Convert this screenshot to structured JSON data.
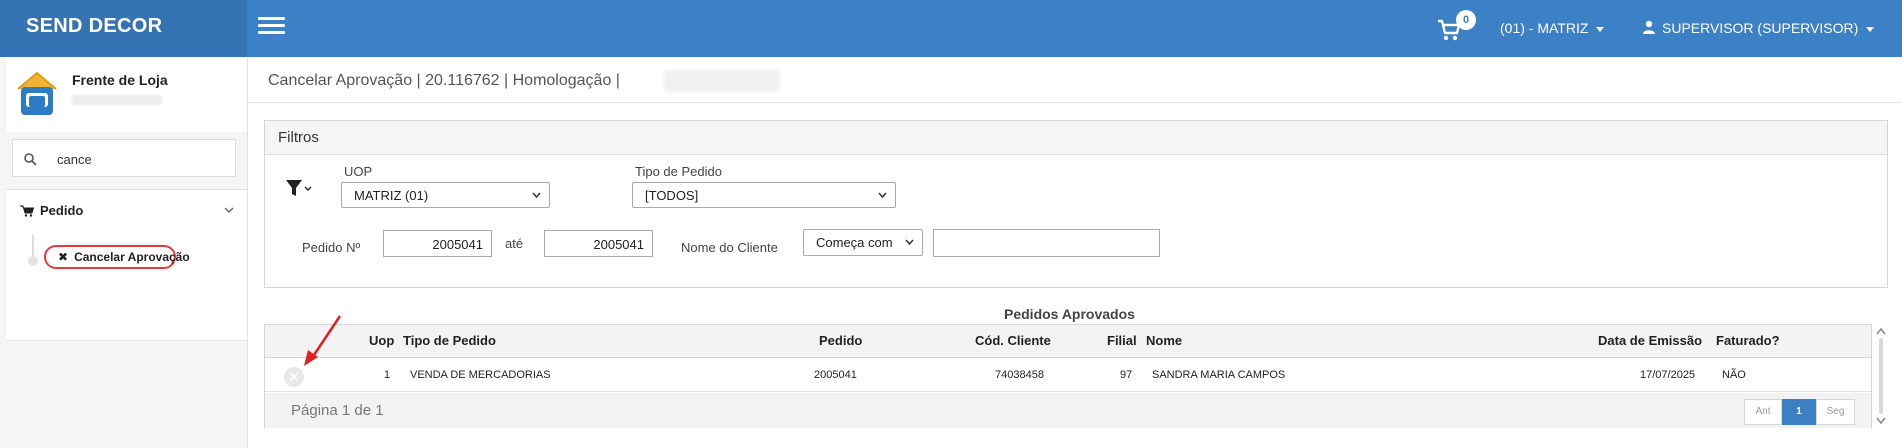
{
  "topbar": {
    "brand": "SEND DECOR",
    "cart_count": "0",
    "branch": "(01) - MATRIZ",
    "user": "SUPERVISOR (SUPERVISOR)"
  },
  "sidebar": {
    "app_title": "Frente de Loja",
    "search_value": "cance",
    "menu": {
      "group_label": "Pedido",
      "active_item": "Cancelar Aprovação"
    }
  },
  "page": {
    "title": "Cancelar Aprovação | 20.116762 | Homologação |"
  },
  "filters": {
    "header": "Filtros",
    "uop_label": "UOP",
    "uop_value": "MATRIZ (01)",
    "tipo_label": "Tipo de Pedido",
    "tipo_value": "[TODOS]",
    "pedido_label": "Pedido Nº",
    "pedido_from": "2005041",
    "ate_label": "até",
    "pedido_to": "2005041",
    "cliente_label": "Nome do Cliente",
    "cliente_mode": "Começa com",
    "cliente_value": ""
  },
  "table": {
    "title": "Pedidos Aprovados",
    "columns": [
      "Uop",
      "Tipo de Pedido",
      "Pedido",
      "Cód. Cliente",
      "Filial",
      "Nome",
      "Data de Emissão",
      "Faturado?"
    ],
    "rows": [
      {
        "uop": "1",
        "tipo": "VENDA DE MERCADORIAS",
        "pedido": "2005041",
        "cod_cliente": "74038458",
        "filial": "97",
        "nome": "SANDRA MARIA CAMPOS",
        "data_emissao": "17/07/2025",
        "faturado": "NÃO"
      }
    ],
    "pagination": {
      "text": "Página 1 de 1",
      "prev": "Ant",
      "current": "1",
      "next": "Seg"
    }
  },
  "colors": {
    "topbar": "#3c80c6",
    "brand_bg": "#3573b4",
    "highlight_border": "#e23b3b",
    "pager_active": "#3c7fc2"
  }
}
